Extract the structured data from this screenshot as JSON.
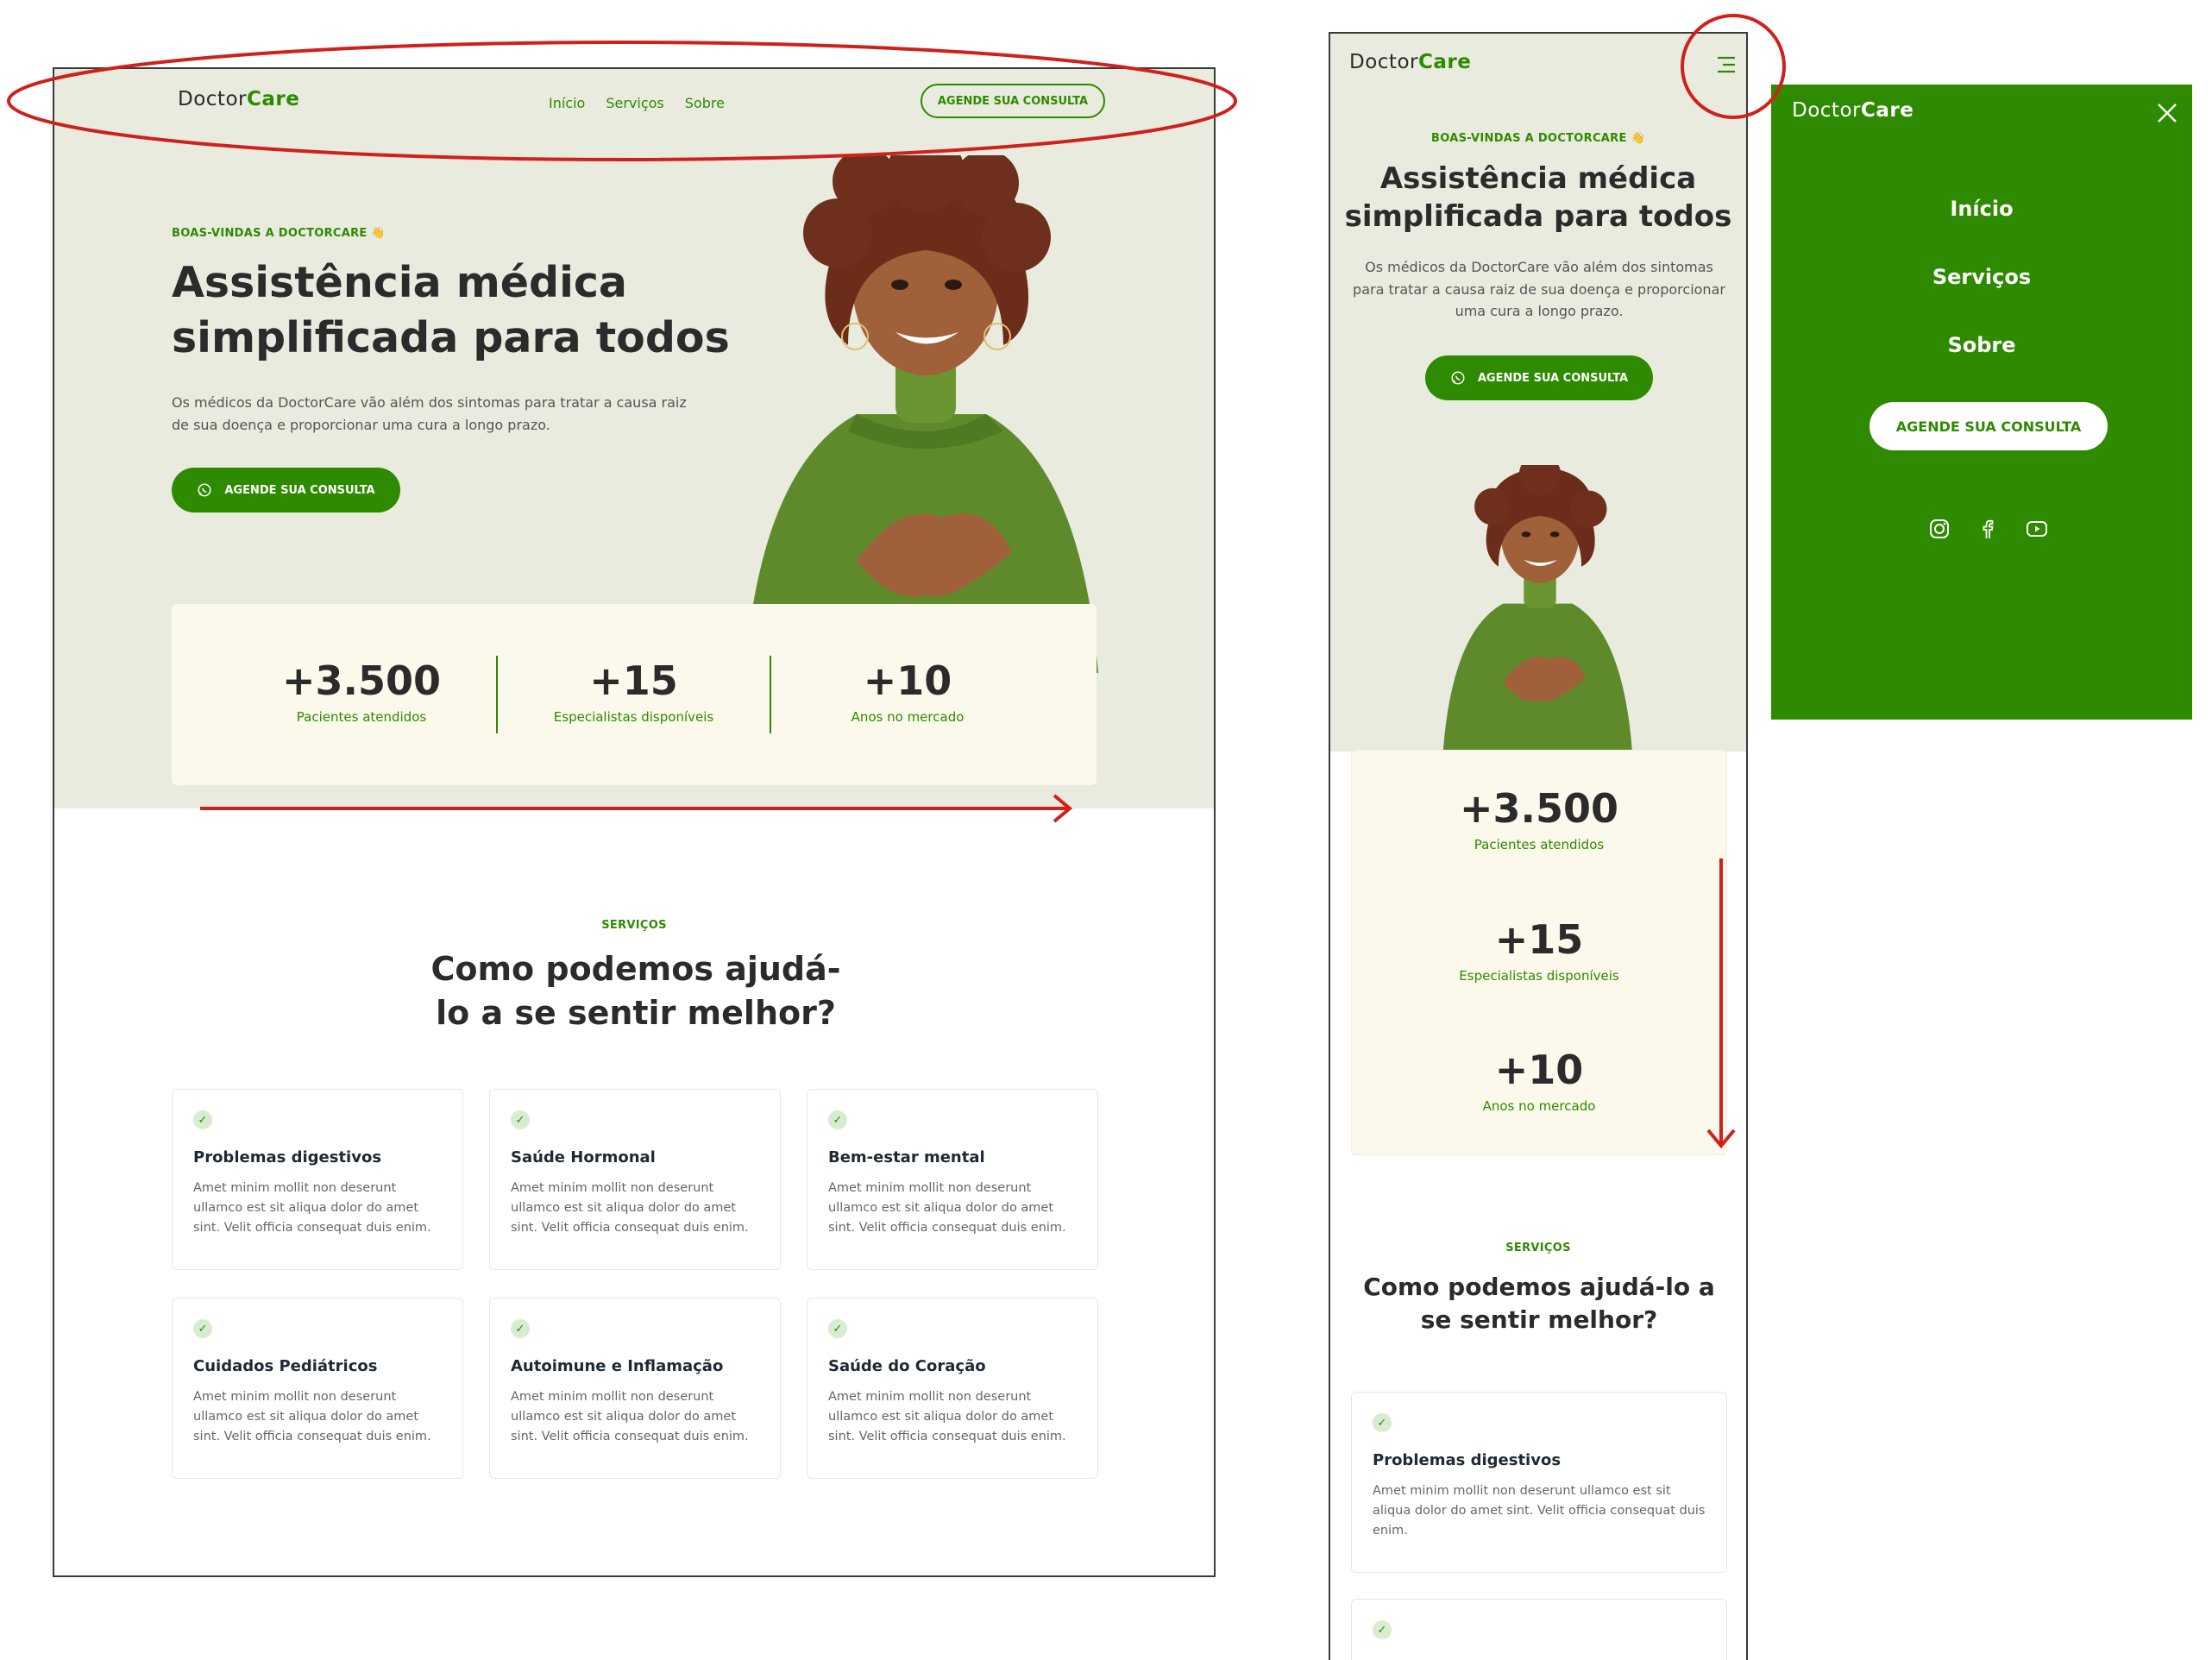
{
  "brand": {
    "prefix": "Doctor",
    "suffix": "Care"
  },
  "nav": {
    "items": [
      "Início",
      "Serviços",
      "Sobre"
    ],
    "cta": "AGENDE SUA CONSULTA"
  },
  "hero": {
    "eyebrow": "BOAS-VINDAS A DOCTORCARE 👋",
    "title_line1": "Assistência médica",
    "title_line2": "simplificada para todos",
    "description": "Os médicos da DoctorCare vão além dos sintomas para tratar a causa raiz de sua doença e proporcionar uma cura a longo prazo.",
    "cta": "AGENDE SUA CONSULTA"
  },
  "stats": [
    {
      "value": "+3.500",
      "label": "Pacientes atendidos"
    },
    {
      "value": "+15",
      "label": "Especialistas disponíveis"
    },
    {
      "value": "+10",
      "label": "Anos no mercado"
    }
  ],
  "services": {
    "eyebrow": "SERVIÇOS",
    "title": "Como podemos ajudá-lo a se sentir melhor?",
    "cards": [
      {
        "title": "Problemas digestivos",
        "text": "Amet minim mollit non deserunt ullamco est sit aliqua dolor do amet sint. Velit officia consequat duis enim."
      },
      {
        "title": "Saúde Hormonal",
        "text": "Amet minim mollit non deserunt ullamco est sit aliqua dolor do amet sint. Velit officia consequat duis enim."
      },
      {
        "title": "Bem-estar mental",
        "text": "Amet minim mollit non deserunt ullamco est sit aliqua dolor do amet sint. Velit officia consequat duis enim."
      },
      {
        "title": "Cuidados Pediátricos",
        "text": "Amet minim mollit non deserunt ullamco est sit aliqua dolor do amet sint. Velit officia consequat duis enim."
      },
      {
        "title": "Autoimune e Inflamação",
        "text": "Amet minim mollit non deserunt ullamco est sit aliqua dolor do amet sint. Velit officia consequat duis enim."
      },
      {
        "title": "Saúde do Coração",
        "text": "Amet minim mollit non deserunt ullamco est sit aliqua dolor do amet sint. Velit officia consequat duis enim."
      }
    ]
  },
  "menu": {
    "items": [
      "Início",
      "Serviços",
      "Sobre"
    ],
    "cta": "AGENDE SUA CONSULTA",
    "social_icons": [
      "instagram-icon",
      "facebook-icon",
      "youtube-icon"
    ]
  },
  "colors": {
    "brand_green": "#2e8a00",
    "hero_bg": "#e9ebde",
    "stats_bg": "#fbf9ec",
    "annotation_red": "#d0201c"
  }
}
